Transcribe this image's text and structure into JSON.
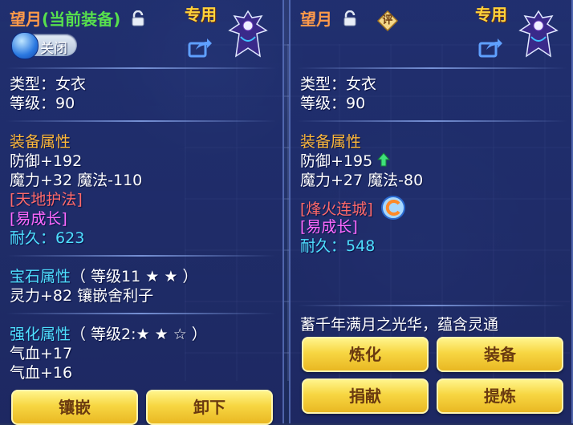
{
  "left": {
    "title_name": "望月",
    "title_state": "(当前装备)",
    "exclusive_label": "专用",
    "toggle_label": "关闭",
    "type_line": "类型：女衣",
    "level_line": "等级：90",
    "attr_heading": "装备属性",
    "defense_line": "防御+192",
    "magic_line": "魔力+32 魔法-110",
    "skill_1": "[天地护法]",
    "skill_2": "[易成长]",
    "durability_label": "耐久：",
    "durability_value": "623",
    "gem_heading": "宝石属性",
    "gem_level": "（ 等级11 ★ ★ ）",
    "gem_line": "灵力+82 镶嵌舍利子",
    "strength_heading": "强化属性",
    "strength_level": "（ 等级2:★ ★ ☆ ）",
    "strength_line_1": "气血+17",
    "strength_line_2": "气血+16",
    "button_inlay": "镶嵌",
    "button_unequip": "卸下"
  },
  "right": {
    "title_name": "望月",
    "rate_icon_text": "评",
    "exclusive_label": "专用",
    "type_line": "类型：女衣",
    "level_line": "等级：90",
    "attr_heading": "装备属性",
    "defense_line": "防御+195",
    "magic_line": "魔力+27 魔法-80",
    "skill_1": "[烽火连城]",
    "skill_2": "[易成长]",
    "durability_label": "耐久：",
    "durability_value": "548",
    "description": "蓄千年满月之光华，蕴含灵通",
    "button_refine": "炼化",
    "button_equip": "装备",
    "button_donate": "捐献",
    "button_extract": "提炼"
  },
  "icons": {
    "lock": "lock-icon",
    "share": "share-icon",
    "up_arrow": "green-up-arrow-icon",
    "skill": "swirl-skill-icon"
  },
  "colors": {
    "title": "#ff9a4a",
    "current_equip": "#57e04d",
    "section": "#ffb93a",
    "durability": "#4fe0ff",
    "button": "#f7d642"
  }
}
